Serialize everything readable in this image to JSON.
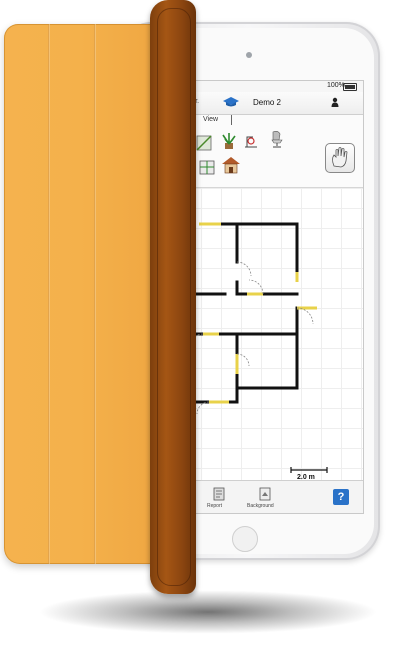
{
  "device": {
    "status_bar": {
      "battery": "100%"
    },
    "nav_bar": {
      "left_label": "orr.",
      "title": "Demo 2",
      "cap_icon": "graduation-cap-icon",
      "user_icon": "person-icon"
    },
    "toolbar": {
      "view_tab_label": "View",
      "tools": [
        "wall-tool-icon",
        "plant-icon",
        "dimension-tool-icon",
        "chair-icon",
        "window-tool-icon",
        "house-icon"
      ],
      "hand_tool_icon": "hand-icon"
    },
    "plan": {
      "scale_label": "2.0 m"
    },
    "bottom_bar": {
      "items": [
        {
          "label": "Report",
          "icon": "report-icon"
        },
        {
          "label": "Background",
          "icon": "background-icon"
        }
      ],
      "help_label": "?"
    }
  },
  "colors": {
    "cover": "#f4b14b",
    "spine": "#8b4510",
    "accent": "#2a72c8"
  }
}
